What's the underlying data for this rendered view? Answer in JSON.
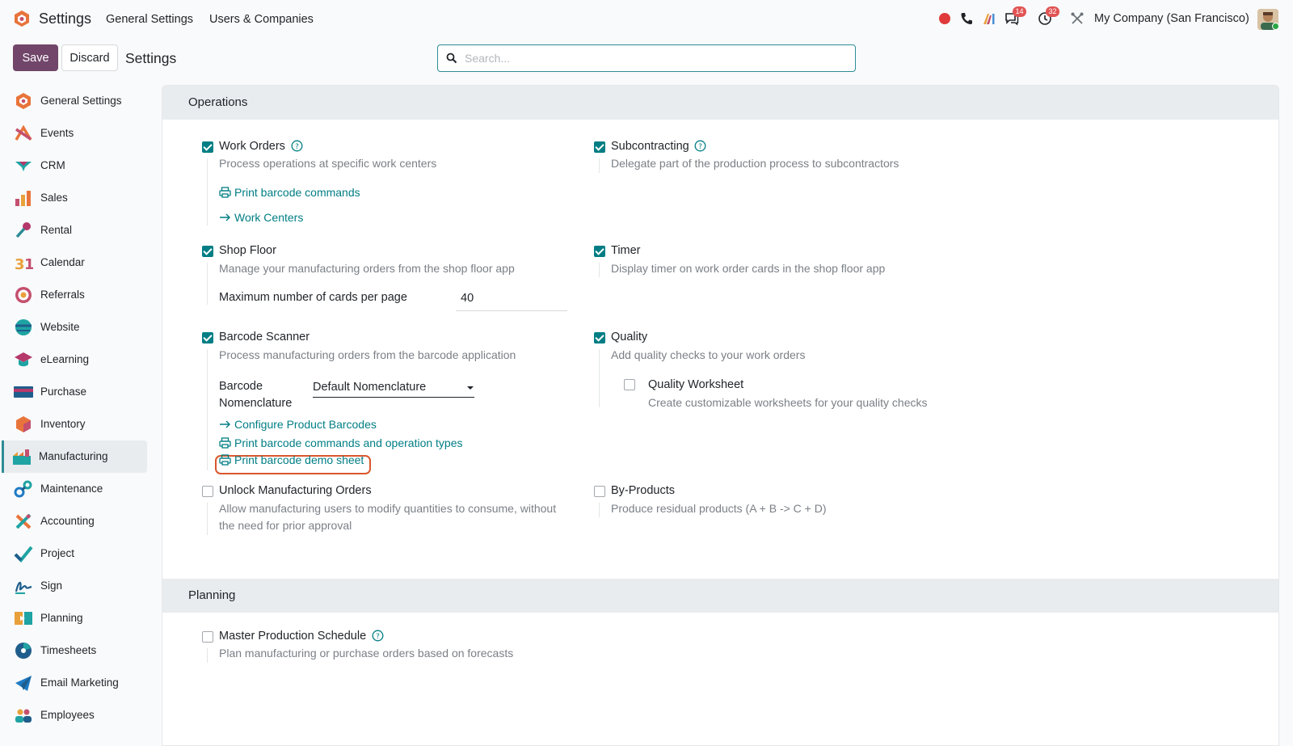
{
  "topbar": {
    "app_title": "Settings",
    "nav": [
      "General Settings",
      "Users & Companies"
    ],
    "messages_count": "14",
    "activities_count": "32",
    "company": "My Company (San Francisco)"
  },
  "controls": {
    "save_label": "Save",
    "discard_label": "Discard",
    "breadcrumb": "Settings",
    "search_placeholder": "Search..."
  },
  "sidebar": {
    "active": "Manufacturing",
    "items": [
      {
        "label": "General Settings",
        "icon": "general-settings-icon"
      },
      {
        "label": "Events",
        "icon": "events-icon"
      },
      {
        "label": "CRM",
        "icon": "crm-icon"
      },
      {
        "label": "Sales",
        "icon": "sales-icon"
      },
      {
        "label": "Rental",
        "icon": "rental-icon"
      },
      {
        "label": "Calendar",
        "icon": "calendar-icon"
      },
      {
        "label": "Referrals",
        "icon": "referrals-icon"
      },
      {
        "label": "Website",
        "icon": "website-icon"
      },
      {
        "label": "eLearning",
        "icon": "elearning-icon"
      },
      {
        "label": "Purchase",
        "icon": "purchase-icon"
      },
      {
        "label": "Inventory",
        "icon": "inventory-icon"
      },
      {
        "label": "Manufacturing",
        "icon": "manufacturing-icon"
      },
      {
        "label": "Maintenance",
        "icon": "maintenance-icon"
      },
      {
        "label": "Accounting",
        "icon": "accounting-icon"
      },
      {
        "label": "Project",
        "icon": "project-icon"
      },
      {
        "label": "Sign",
        "icon": "sign-icon"
      },
      {
        "label": "Planning",
        "icon": "planning-icon"
      },
      {
        "label": "Timesheets",
        "icon": "timesheets-icon"
      },
      {
        "label": "Email Marketing",
        "icon": "email-marketing-icon"
      },
      {
        "label": "Employees",
        "icon": "employees-icon"
      }
    ]
  },
  "operations": {
    "title": "Operations",
    "work_orders": {
      "title": "Work Orders",
      "desc": "Process operations at specific work centers",
      "checked": true
    },
    "print_barcode_commands": "Print barcode commands",
    "work_centers": "Work Centers",
    "subcontracting": {
      "title": "Subcontracting",
      "desc": "Delegate part of the production process to subcontractors",
      "checked": true
    },
    "shop_floor": {
      "title": "Shop Floor",
      "desc": "Manage your manufacturing orders from the shop floor app",
      "checked": true
    },
    "max_cards_label": "Maximum number of cards per page",
    "max_cards_value": "40",
    "timer": {
      "title": "Timer",
      "desc": "Display timer on work order cards in the shop floor app",
      "checked": true
    },
    "barcode_scanner": {
      "title": "Barcode Scanner",
      "desc": "Process manufacturing orders from the barcode application",
      "checked": true
    },
    "barcode_nomenclature_label_1": "Barcode",
    "barcode_nomenclature_label_2": "Nomenclature",
    "barcode_nomenclature_value": "Default Nomenclature",
    "configure_product_barcodes": "Configure Product Barcodes",
    "print_commands_operation_types": "Print barcode commands and operation types",
    "print_demo_sheet": "Print barcode demo sheet",
    "quality": {
      "title": "Quality",
      "desc": "Add quality checks to your work orders",
      "checked": true
    },
    "quality_worksheet": {
      "title": "Quality Worksheet",
      "desc": "Create customizable worksheets for your quality checks",
      "checked": false
    },
    "unlock_mo": {
      "title": "Unlock Manufacturing Orders",
      "desc_1": "Allow manufacturing users to modify quantities to consume, without",
      "desc_2": "the need for prior approval",
      "checked": false
    },
    "by_products": {
      "title": "By-Products",
      "desc": "Produce residual products (A + B -> C + D)",
      "checked": false
    }
  },
  "planning": {
    "title": "Planning",
    "mps": {
      "title": "Master Production Schedule",
      "desc": "Plan manufacturing or purchase orders based on forecasts",
      "checked": false
    }
  },
  "colors": {
    "brand": "#71466a",
    "accent": "#017e84",
    "highlight": "#d9572d"
  }
}
